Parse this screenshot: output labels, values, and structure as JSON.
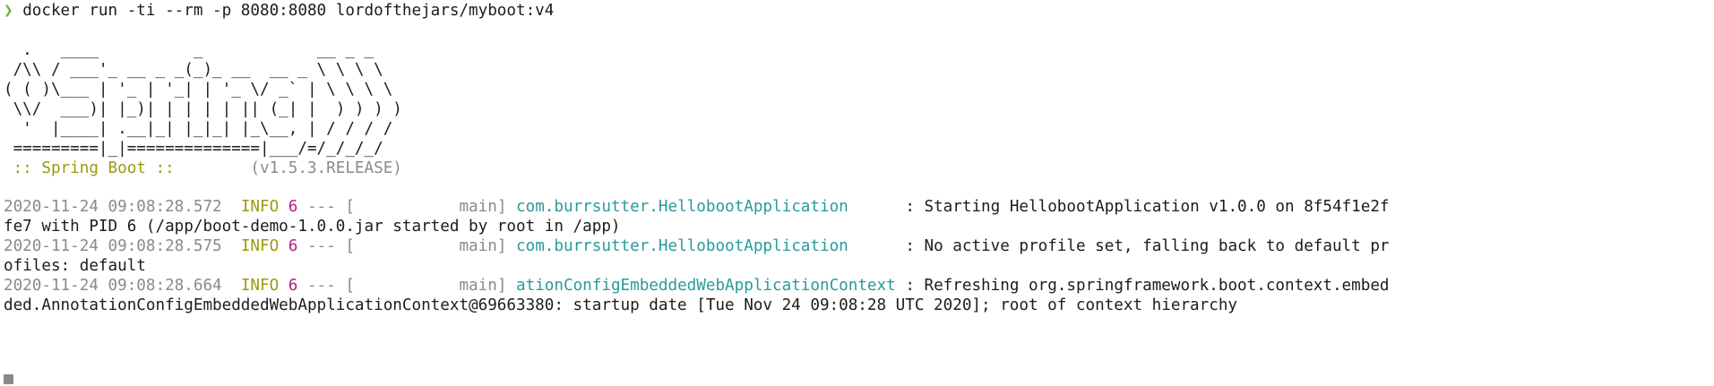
{
  "command": {
    "prompt": "❯",
    "text": "docker run -ti --rm -p 8080:8080 lordofthejars/myboot:v4"
  },
  "banner": [
    "  .   ____          _            __ _ _",
    " /\\\\ / ___'_ __ _ _(_)_ __  __ _ \\ \\ \\ \\",
    "( ( )\\___ | '_ | '_| | '_ \\/ _` | \\ \\ \\ \\",
    " \\\\/  ___)| |_)| | | | | || (_| |  ) ) ) )",
    "  '  |____| .__|_| |_|_| |_\\__, | / / / /",
    " =========|_|==============|___/=/_/_/_/"
  ],
  "spring_label": " :: Spring Boot :: ",
  "spring_version": "       (v1.5.3.RELEASE)",
  "logs": [
    {
      "ts": "2020-11-24 09:08:28.572",
      "level": "INFO",
      "pid": "6",
      "dashes": "---",
      "thread": "[           main]",
      "logger": "com.burrsutter.HellobootApplication",
      "logger_pad": "      ",
      "message": ": Starting HellobootApplication v1.0.0 on 8f54f1e2f",
      "wrap": "fe7 with PID 6 (/app/boot-demo-1.0.0.jar started by root in /app)"
    },
    {
      "ts": "2020-11-24 09:08:28.575",
      "level": "INFO",
      "pid": "6",
      "dashes": "---",
      "thread": "[           main]",
      "logger": "com.burrsutter.HellobootApplication",
      "logger_pad": "      ",
      "message": ": No active profile set, falling back to default pr",
      "wrap": "ofiles: default"
    },
    {
      "ts": "2020-11-24 09:08:28.664",
      "level": "INFO",
      "pid": "6",
      "dashes": "---",
      "thread": "[           main]",
      "logger": "ationConfigEmbeddedWebApplicationContext",
      "logger_pad": " ",
      "message": ": Refreshing org.springframework.boot.context.embed",
      "wrap": "ded.AnnotationConfigEmbeddedWebApplicationContext@69663380: startup date [Tue Nov 24 09:08:28 UTC 2020]; root of context hierarchy"
    }
  ],
  "colors": {
    "background": "#ffffff",
    "text": "#1c1c1c",
    "prompt": "#6fb23a",
    "info": "#9a9a10",
    "pid": "#b02080",
    "logger": "#2a9a9a",
    "muted": "#8a8a8a"
  }
}
